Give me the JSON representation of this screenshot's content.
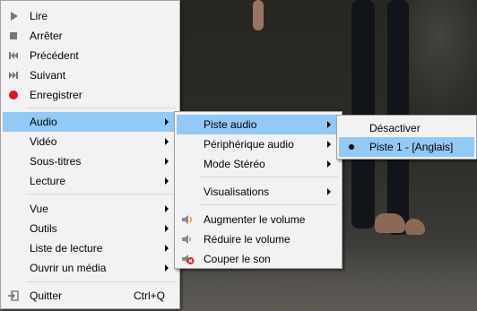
{
  "main_menu": {
    "items": [
      {
        "label": "Lire",
        "icon": "play-icon"
      },
      {
        "label": "Arrêter",
        "icon": "stop-icon"
      },
      {
        "label": "Précédent",
        "icon": "previous-icon"
      },
      {
        "label": "Suivant",
        "icon": "next-icon"
      },
      {
        "label": "Enregistrer",
        "icon": "record-icon"
      },
      {
        "label": "Audio",
        "submenu": true,
        "highlighted": true
      },
      {
        "label": "Vidéo",
        "submenu": true
      },
      {
        "label": "Sous-titres",
        "submenu": true
      },
      {
        "label": "Lecture",
        "submenu": true
      },
      {
        "label": "Vue",
        "submenu": true
      },
      {
        "label": "Outils",
        "submenu": true
      },
      {
        "label": "Liste de lecture",
        "submenu": true
      },
      {
        "label": "Ouvrir un média",
        "submenu": true
      },
      {
        "label": "Quitter",
        "icon": "exit-icon",
        "shortcut": "Ctrl+Q"
      }
    ]
  },
  "audio_menu": {
    "items": [
      {
        "label": "Piste audio",
        "submenu": true,
        "highlighted": true
      },
      {
        "label": "Périphérique audio",
        "submenu": true
      },
      {
        "label": "Mode Stéréo",
        "submenu": true
      },
      {
        "label": "Visualisations",
        "submenu": true
      },
      {
        "label": "Augmenter le volume",
        "icon": "volume-up-icon"
      },
      {
        "label": "Réduire le volume",
        "icon": "volume-down-icon"
      },
      {
        "label": "Couper le son",
        "icon": "mute-icon"
      }
    ]
  },
  "track_menu": {
    "items": [
      {
        "label": "Désactiver"
      },
      {
        "label": "Piste 1 - [Anglais]",
        "selected": true,
        "highlighted": true
      }
    ]
  },
  "colors": {
    "highlight": "#91c9f7",
    "menu_bg": "#f2f2f2",
    "record": "#e81123",
    "mute": "#d9262b"
  }
}
